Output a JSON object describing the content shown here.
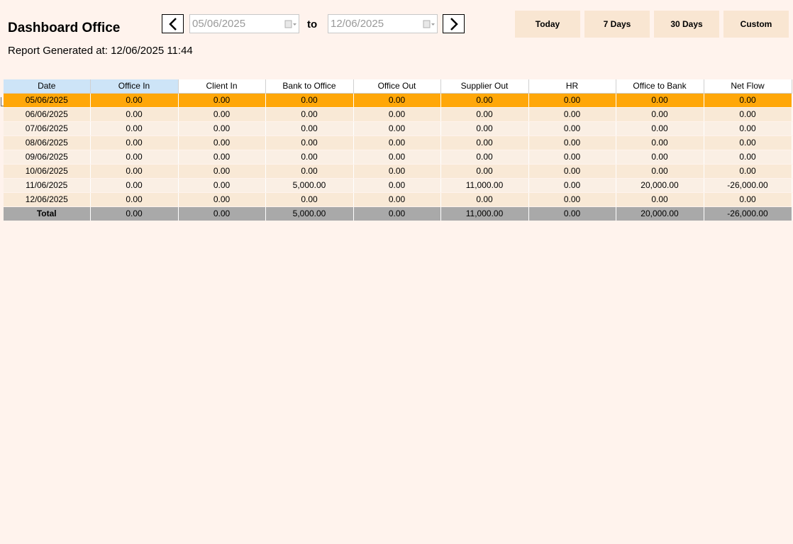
{
  "header": {
    "title": "Dashboard Office",
    "generated": "Report Generated at: 12/06/2025 11:44"
  },
  "date_range": {
    "from": "05/06/2025",
    "to_label": "to",
    "to": "12/06/2025",
    "prev_icon": "chevron-left-icon",
    "next_icon": "chevron-right-icon",
    "calendar_icon": "calendar-icon"
  },
  "ranges": {
    "today": "Today",
    "seven": "7 Days",
    "thirty": "30 Days",
    "custom": "Custom"
  },
  "colors": {
    "background": "#fff3ed",
    "button": "#f9e6d2",
    "selected_row": "#ffa709",
    "total_row": "#a9a9a9",
    "selected_header": "#cde4f7"
  },
  "table": {
    "columns": [
      "Date",
      "Office In",
      "Client In",
      "Bank to Office",
      "Office Out",
      "Supplier Out",
      "HR",
      "Office to Bank",
      "Net Flow"
    ],
    "rows": [
      [
        "05/06/2025",
        "0.00",
        "0.00",
        "0.00",
        "0.00",
        "0.00",
        "0.00",
        "0.00",
        "0.00"
      ],
      [
        "06/06/2025",
        "0.00",
        "0.00",
        "0.00",
        "0.00",
        "0.00",
        "0.00",
        "0.00",
        "0.00"
      ],
      [
        "07/06/2025",
        "0.00",
        "0.00",
        "0.00",
        "0.00",
        "0.00",
        "0.00",
        "0.00",
        "0.00"
      ],
      [
        "08/06/2025",
        "0.00",
        "0.00",
        "0.00",
        "0.00",
        "0.00",
        "0.00",
        "0.00",
        "0.00"
      ],
      [
        "09/06/2025",
        "0.00",
        "0.00",
        "0.00",
        "0.00",
        "0.00",
        "0.00",
        "0.00",
        "0.00"
      ],
      [
        "10/06/2025",
        "0.00",
        "0.00",
        "0.00",
        "0.00",
        "0.00",
        "0.00",
        "0.00",
        "0.00"
      ],
      [
        "11/06/2025",
        "0.00",
        "0.00",
        "5,000.00",
        "0.00",
        "11,000.00",
        "0.00",
        "20,000.00",
        "-26,000.00"
      ],
      [
        "12/06/2025",
        "0.00",
        "0.00",
        "0.00",
        "0.00",
        "0.00",
        "0.00",
        "0.00",
        "0.00"
      ]
    ],
    "total": [
      "Total",
      "0.00",
      "0.00",
      "5,000.00",
      "0.00",
      "11,000.00",
      "0.00",
      "20,000.00",
      "-26,000.00"
    ]
  }
}
